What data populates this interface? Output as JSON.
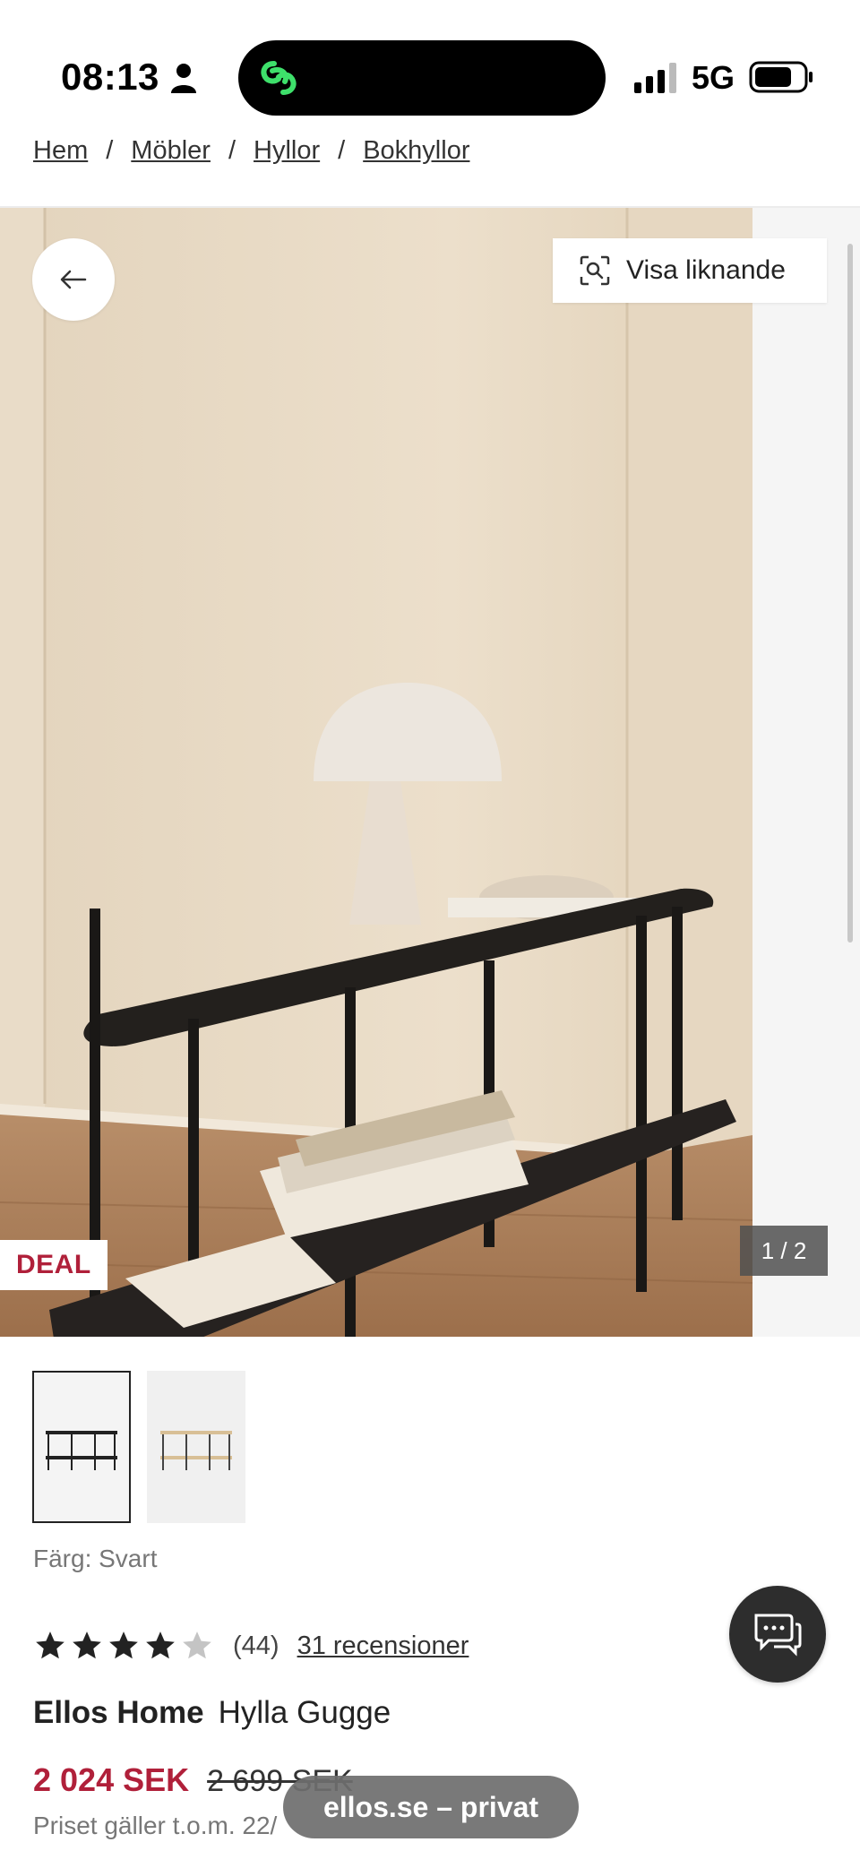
{
  "status_bar": {
    "time": "08:13",
    "network": "5G",
    "icons": [
      "person-icon",
      "app-link-icon",
      "signal-icon",
      "battery-icon"
    ]
  },
  "breadcrumb": {
    "items": [
      "Hem",
      "Möbler",
      "Hyllor",
      "Bokhyllor"
    ],
    "separator": "/"
  },
  "gallery": {
    "similar_label": "Visa liknande",
    "deal_badge": "DEAL",
    "counter": "1 / 2",
    "back_icon": "arrow-left-icon",
    "similar_icon": "visual-search-icon"
  },
  "product": {
    "color_label": "Färg: Svart",
    "rating": 4,
    "rating_max": 5,
    "rating_count": "(44)",
    "reviews_link": "31 recensioner",
    "brand": "Ellos Home",
    "name": "Hylla Gugge",
    "price_current": "2 024 SEK",
    "price_old": "2 699 SEK",
    "price_note": "Priset gäller t.o.m. 22/"
  },
  "site_pill": "ellos.se – privat",
  "colors": {
    "accent": "#b0203a",
    "wall": "#e6d8c3",
    "floor": "#a87b56",
    "shelf": "#1e1b19"
  }
}
